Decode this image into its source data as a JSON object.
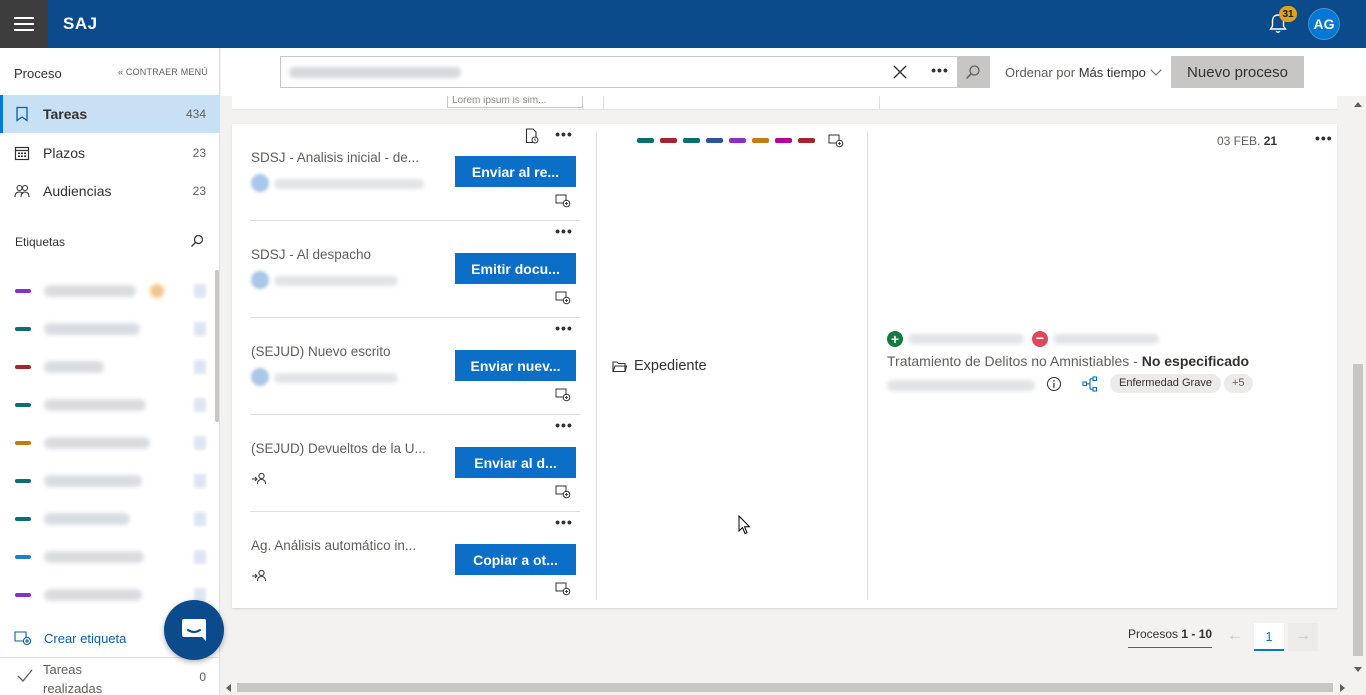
{
  "app": {
    "brand": "SAJ",
    "notifications": "31",
    "user_initials": "AG"
  },
  "sidebar": {
    "header": "Proceso",
    "collapse_label": "« CONTRAER MENÚ",
    "items": [
      {
        "label": "Tareas",
        "count": "434"
      },
      {
        "label": "Plazos",
        "count": "23"
      },
      {
        "label": "Audiencias",
        "count": "23"
      }
    ],
    "tags_title": "Etiquetas",
    "tag_colors": [
      "#8a2fc9",
      "#0b6e73",
      "#a4262c",
      "#0b6e73",
      "#c17b0f",
      "#0b6e73",
      "#0b6e73",
      "#1b83c4",
      "#8a2fc9"
    ],
    "create_tag": "Crear etiqueta",
    "done_label": "Tareas realizadas",
    "done_count": "0"
  },
  "toolbar": {
    "search_placeholder": "",
    "more": "•••",
    "sort_prefix": "Ordenar por",
    "sort_value": "Más tiempo",
    "new_button": "Nuevo proceso"
  },
  "card_top": {
    "snippet": "Lorem ipsum is sim..."
  },
  "tasks": [
    {
      "title": "SDSJ - Analisis inicial - de...",
      "action": "Enviar al re..."
    },
    {
      "title": "SDSJ - Al despacho",
      "action": "Emitir docu..."
    },
    {
      "title": "(SEJUD) Nuevo escrito",
      "action": "Enviar nuev..."
    },
    {
      "title": "(SEJUD) Devueltos de la U...",
      "action": "Enviar al d..."
    },
    {
      "title": "Ag. Análisis automático in...",
      "action": "Copiar a ot..."
    }
  ],
  "tag_strip_colors": [
    "#0b6e73",
    "#a4262c",
    "#0b6e73",
    "#2b579a",
    "#8a2fc9",
    "#c17b0f",
    "#b4009e",
    "#a4262c"
  ],
  "expediente_label": "Expediente",
  "detail": {
    "date_prefix": "03 FEB.",
    "date_suffix": "21",
    "crime_title": "Tratamiento de Delitos no Amnistiables",
    "crime_separator": " - ",
    "crime_status": "No especificado",
    "chip_label": "Enfermedad Grave",
    "chip_more": "+5"
  },
  "pager": {
    "label_prefix": "Procesos",
    "range": "1 - 10",
    "prev": "←",
    "current": "1",
    "next": "→"
  }
}
